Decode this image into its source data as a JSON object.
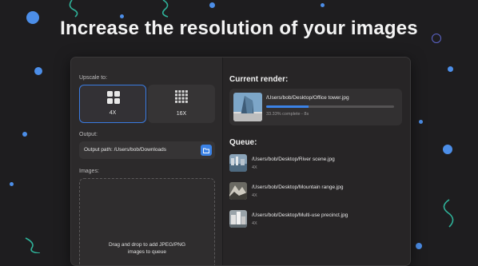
{
  "headline": "Increase the resolution of your images",
  "window": {
    "left": {
      "upscale_label": "Upscale to:",
      "options": [
        {
          "label": "4X",
          "selected": true
        },
        {
          "label": "16X",
          "selected": false
        }
      ],
      "output_label": "Output:",
      "output_path": "Output path: /Users/bob/Downloads",
      "images_label": "Images:",
      "drop_text_1": "Drag and drop to add JPEG/PNG",
      "drop_text_2": "images to queue"
    },
    "right": {
      "current_heading": "Current render:",
      "current": {
        "file": "/Users/bob/Desktop/Office tower.jpg",
        "progress_text": "33.33% complete - 8s",
        "progress": 0.3333
      },
      "queue_heading": "Queue:",
      "queue": [
        {
          "file": "/Users/bob/Desktop/River scene.jpg",
          "scale": "4X"
        },
        {
          "file": "/Users/bob/Desktop/Mountain range.jpg",
          "scale": "4X"
        },
        {
          "file": "/Users/bob/Desktop/Multi-use precinct.jpg",
          "scale": "4X"
        }
      ]
    }
  },
  "colors": {
    "accent": "#3b82e6",
    "background": "#1e1d1f",
    "decor_dot": "#4c8ee8",
    "decor_ring": "#5c64c9",
    "decor_squiggle": "#2fb39a"
  },
  "icons": [
    "grid-2x2-icon",
    "grid-4x4-icon",
    "folder-icon"
  ]
}
